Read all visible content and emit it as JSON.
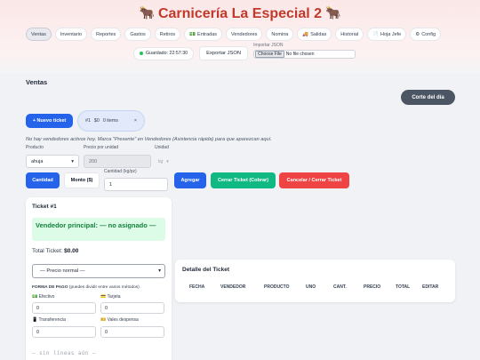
{
  "app": {
    "title": "Carnicería La Especial 2",
    "cow_left": "🐂",
    "cow_right": "🐂"
  },
  "nav": [
    {
      "icon": "",
      "label": "Ventas",
      "active": true
    },
    {
      "icon": "",
      "label": "Inventario"
    },
    {
      "icon": "",
      "label": "Reportes"
    },
    {
      "icon": "",
      "label": "Gastos"
    },
    {
      "icon": "",
      "label": "Retiros"
    },
    {
      "icon": "💵",
      "label": "Entradas"
    },
    {
      "icon": "",
      "label": "Vendedores"
    },
    {
      "icon": "",
      "label": "Nomina"
    },
    {
      "icon": "🚚",
      "label": "Salidas"
    },
    {
      "icon": "",
      "label": "Historial"
    },
    {
      "icon": "📄",
      "label": "Hoja Jefe"
    },
    {
      "icon": "⚙",
      "label": "Config"
    }
  ],
  "status": {
    "saved": "Guardado: 22:57:30",
    "export": "Exportar JSON",
    "import_label": "Importar JSON",
    "file_button": "Choose File",
    "file_status": "No file chosen"
  },
  "ventas": {
    "title": "Ventas",
    "corte": "Corte del día",
    "nuevo_ticket": "+ Nuevo ticket",
    "tab": {
      "name": "#1",
      "amount": "$0",
      "items": "0 items",
      "close": "×"
    },
    "warning": "No hay vendedores activos hoy. Marca \"Presente\" en Vendedores (Asistencia rápida) para que aparezcan aquí.",
    "producto_label": "Producto",
    "producto_value": "ahuja",
    "precio_label": "Precio por unidad",
    "precio_value": "200",
    "unidad_label": "Unidad",
    "unidad_value": "kg",
    "cantidad_label": "Cantidad (kg/pz)",
    "cantidad_value": "1",
    "mode_cantidad": "Cantidad",
    "mode_monto": "Monto ($)",
    "agregar": "Agregar",
    "cerrar": "Cerrar Ticket (Cobrar)",
    "cancelar": "Cancelar / Cerrar Ticket"
  },
  "ticket": {
    "title": "Ticket #1",
    "vendedor": "Vendedor principal: — no asignado —",
    "total_label": "Total Ticket:",
    "total_value": "$0.00",
    "precio_select": "— Precio normal —",
    "forma_title": "FORMA DE PAGO",
    "forma_hint": "(puedes dividir entre varios métodos)",
    "efectivo": "💵 Efectivo",
    "efectivo_value": "0",
    "tarjeta": "💳 Tarjeta",
    "tarjeta_value": "0",
    "transferencia": "📱 Transferencia",
    "transferencia_value": "0",
    "vales": "🎫 Vales despensa",
    "vales_value": "0",
    "empty": "— sin líneas aún —"
  },
  "detalle": {
    "title": "Detalle del Ticket",
    "headers": [
      "FECHA",
      "VENDEDOR",
      "PRODUCTO",
      "UNO",
      "CANT.",
      "PRECIO",
      "TOTAL",
      "EDITAR"
    ]
  }
}
